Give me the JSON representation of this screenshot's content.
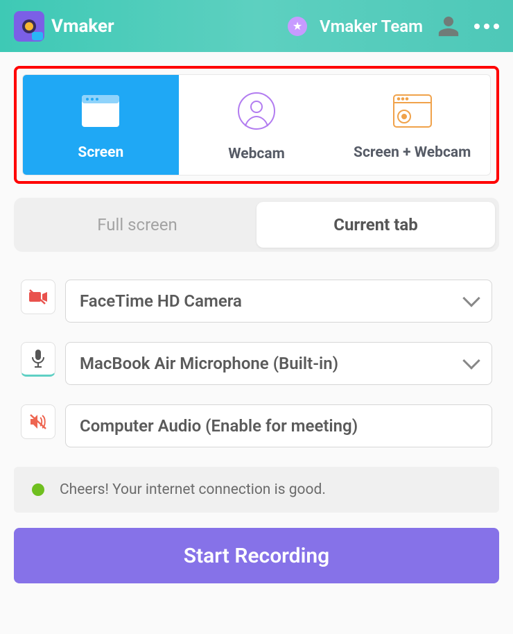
{
  "header": {
    "app_name": "Vmaker",
    "team_label": "Vmaker Team"
  },
  "modes": {
    "screen": "Screen",
    "webcam": "Webcam",
    "screen_webcam": "Screen + Webcam",
    "selected": "screen"
  },
  "capture": {
    "full_screen": "Full screen",
    "current_tab": "Current tab",
    "selected": "current_tab"
  },
  "devices": {
    "camera": "FaceTime HD Camera",
    "microphone": "MacBook Air Microphone (Built-in)",
    "audio": "Computer Audio (Enable for meeting)"
  },
  "status": {
    "message": "Cheers! Your internet connection is good.",
    "ok": true
  },
  "actions": {
    "start": "Start Recording"
  }
}
